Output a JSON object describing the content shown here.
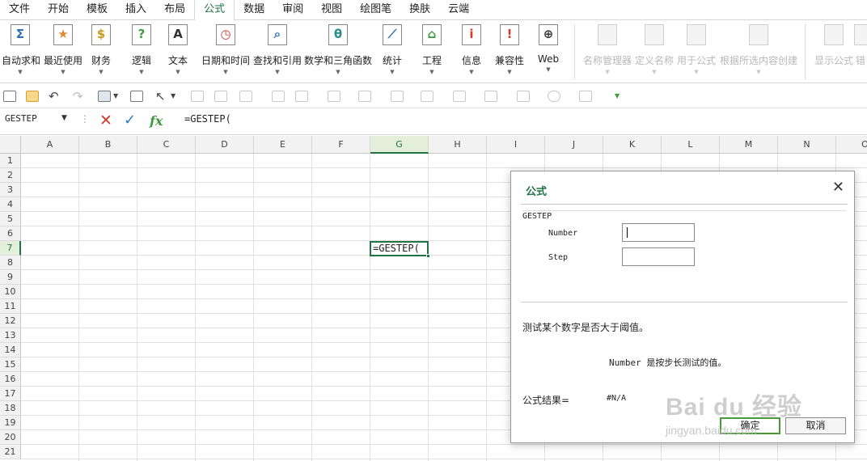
{
  "menu": [
    "文件",
    "开始",
    "模板",
    "插入",
    "布局",
    "公式",
    "数据",
    "审阅",
    "视图",
    "绘图笔",
    "换肤",
    "云端"
  ],
  "menu_active_index": 5,
  "ribbon": {
    "buttons": [
      {
        "label": "自动求和",
        "glyph": "Σ",
        "icon": "autosum-icon",
        "color": "#2f6fb5"
      },
      {
        "label": "最近使用",
        "glyph": "★",
        "icon": "star-icon",
        "color": "#e3862d"
      },
      {
        "label": "财务",
        "glyph": "$",
        "icon": "money-bag-icon",
        "color": "#c79a1c"
      },
      {
        "label": "逻辑",
        "glyph": "?",
        "icon": "logic-icon",
        "color": "#3c9a3c"
      },
      {
        "label": "文本",
        "glyph": "A",
        "icon": "text-icon",
        "color": "#333333"
      },
      {
        "label": "日期和时间",
        "glyph": "◷",
        "icon": "clock-icon",
        "color": "#d03b2c"
      },
      {
        "label": "查找和引用",
        "glyph": "⌕",
        "icon": "lookup-icon",
        "color": "#2f6fb5"
      },
      {
        "label": "数学和三角函数",
        "glyph": "θ",
        "icon": "math-icon",
        "color": "#2c8c8c"
      },
      {
        "label": "统计",
        "glyph": "⟋",
        "icon": "statistics-icon",
        "color": "#2f6fb5"
      },
      {
        "label": "工程",
        "glyph": "⌂",
        "icon": "engineering-icon",
        "color": "#3c9a3c"
      },
      {
        "label": "信息",
        "glyph": "i",
        "icon": "info-icon",
        "color": "#d03b2c"
      },
      {
        "label": "兼容性",
        "glyph": "!",
        "icon": "compatibility-icon",
        "color": "#d03b2c"
      },
      {
        "label": "Web",
        "glyph": "⊕",
        "icon": "web-icon",
        "color": "#333333"
      }
    ],
    "disabled_buttons": [
      {
        "label": "名称管理器",
        "icon": "name-manager-icon"
      },
      {
        "label": "定义名称",
        "icon": "define-name-icon"
      },
      {
        "label": "用于公式",
        "icon": "use-in-formula-icon"
      },
      {
        "label": "根据所选内容创建",
        "icon": "create-from-selection-icon"
      },
      {
        "label": "显示公式",
        "icon": "show-formulas-icon"
      },
      {
        "label": "错",
        "icon": "error-check-icon"
      }
    ]
  },
  "formula_bar": {
    "name_box": "GESTEP",
    "content": "=GESTEP("
  },
  "grid": {
    "columns": [
      "A",
      "B",
      "C",
      "D",
      "E",
      "F",
      "G",
      "H",
      "I",
      "J",
      "K",
      "L",
      "M",
      "N",
      "O"
    ],
    "rows": [
      "1",
      "2",
      "3",
      "4",
      "5",
      "6",
      "7",
      "8",
      "9",
      "10",
      "11",
      "12",
      "13",
      "14",
      "15",
      "16",
      "17",
      "18",
      "19",
      "20",
      "21"
    ],
    "active_column": "G",
    "active_row": "7",
    "active_cell_text": "=GESTEP("
  },
  "dialog": {
    "title": "公式",
    "function_name": "GESTEP",
    "arguments": [
      {
        "label": "Number",
        "value": ""
      },
      {
        "label": "Step",
        "value": ""
      }
    ],
    "description": "测试某个数字是否大于阈值。",
    "argument_description": "Number 是按步长测试的值。",
    "result_label": "公式结果=",
    "result_value": "#N/A",
    "ok_label": "确定",
    "cancel_label": "取消"
  },
  "watermark": {
    "logo": "Bai du 经验",
    "url": "jingyan.baidu.com"
  }
}
